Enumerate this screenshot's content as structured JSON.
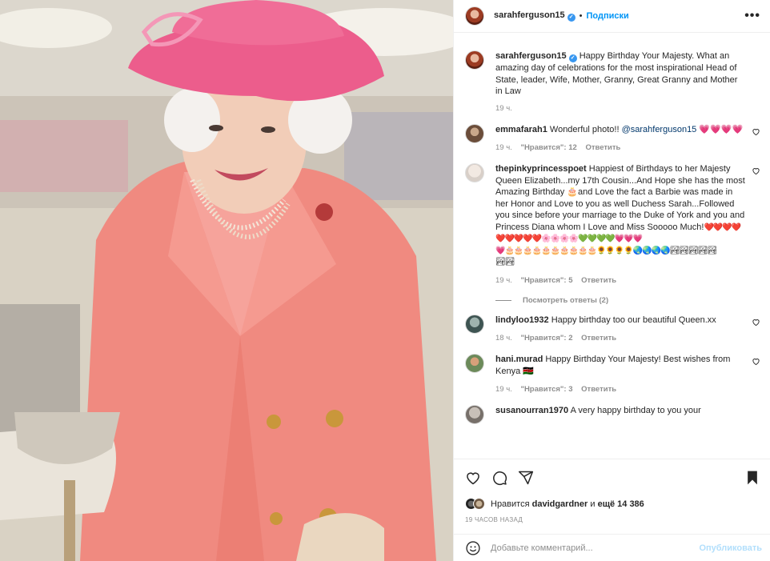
{
  "post_author": {
    "username": "sarahferguson15",
    "verified": true,
    "follow_label": "Подписки",
    "separator": "•",
    "more_label": "•••"
  },
  "caption": {
    "username": "sarahferguson15",
    "text": "Happy Birthday Your Majesty. What an amazing day of celebrations for the most inspirational Head of State, leader, Wife, Mother, Granny, Great Granny and Mother in Law",
    "time": "19 ч."
  },
  "comments": [
    {
      "username": "emmafarah1",
      "text": "Wonderful photo!! ",
      "mention": "@sarahferguson15",
      "emoji": "💗💗💗💗",
      "time": "19 ч.",
      "likes": "\"Нравится\": 12",
      "reply": "Ответить"
    },
    {
      "username": "thepinkyprincesspoet",
      "text": "Happiest of Birthdays to her Majesty Queen Elizabeth...my 17th Cousin...And Hope she has the most Amazing Birthday 🎂and Love the fact a Barbie was made in her Honor and Love to you as well Duchess Sarah...Followed you since before your marriage to the Duke of York and you and Princess Diana whom I Love and Miss Sooooo Much!",
      "emoji_line1": "❤️❤️❤️❤️❤️❤️❤️❤️❤️🌸🌸🌸🌸💚💚💚💚💗💗💗",
      "emoji_line2": "💗🎂🎂🎂🎂🎂🎂🎂🎂🎂🎂🌻🌻🌻🌻🌏🌏🌏🌏🏞🏞🏞🏞🏞",
      "emoji_line3": "🏞🏞",
      "time": "19 ч.",
      "likes": "\"Нравится\": 5",
      "reply": "Ответить",
      "view_replies": "Посмотреть ответы (2)"
    },
    {
      "username": "lindyloo1932",
      "text": "Happy birthday too our beautiful Queen.xx",
      "time": "18 ч.",
      "likes": "\"Нравится\": 2",
      "reply": "Ответить"
    },
    {
      "username": "hani.murad",
      "text": "Happy Birthday Your Majesty! Best wishes from Kenya 🇰🇪",
      "time": "19 ч.",
      "likes": "\"Нравится\": 3",
      "reply": "Ответить"
    },
    {
      "username": "susanourran1970",
      "text": "A very happy birthday to you your"
    }
  ],
  "likes_line": {
    "prefix": "Нравится",
    "user": "davidgardner",
    "middle": "и",
    "count": "ещё 14 386"
  },
  "timestamp": "19 ЧАСОВ НАЗАД",
  "add_comment": {
    "placeholder": "Добавьте комментарий...",
    "publish_label": "Опубликовать"
  },
  "colors": {
    "accent": "#0095f6",
    "publish_disabled": "#b2dffc",
    "muted": "#8e8e8e",
    "verified": "#3897f0",
    "coat": "#f08a80",
    "hat": "#ec5d8c"
  },
  "icons": [
    "heart-icon",
    "comment-icon",
    "share-icon",
    "bookmark-icon",
    "emoji-icon",
    "more-icon"
  ]
}
